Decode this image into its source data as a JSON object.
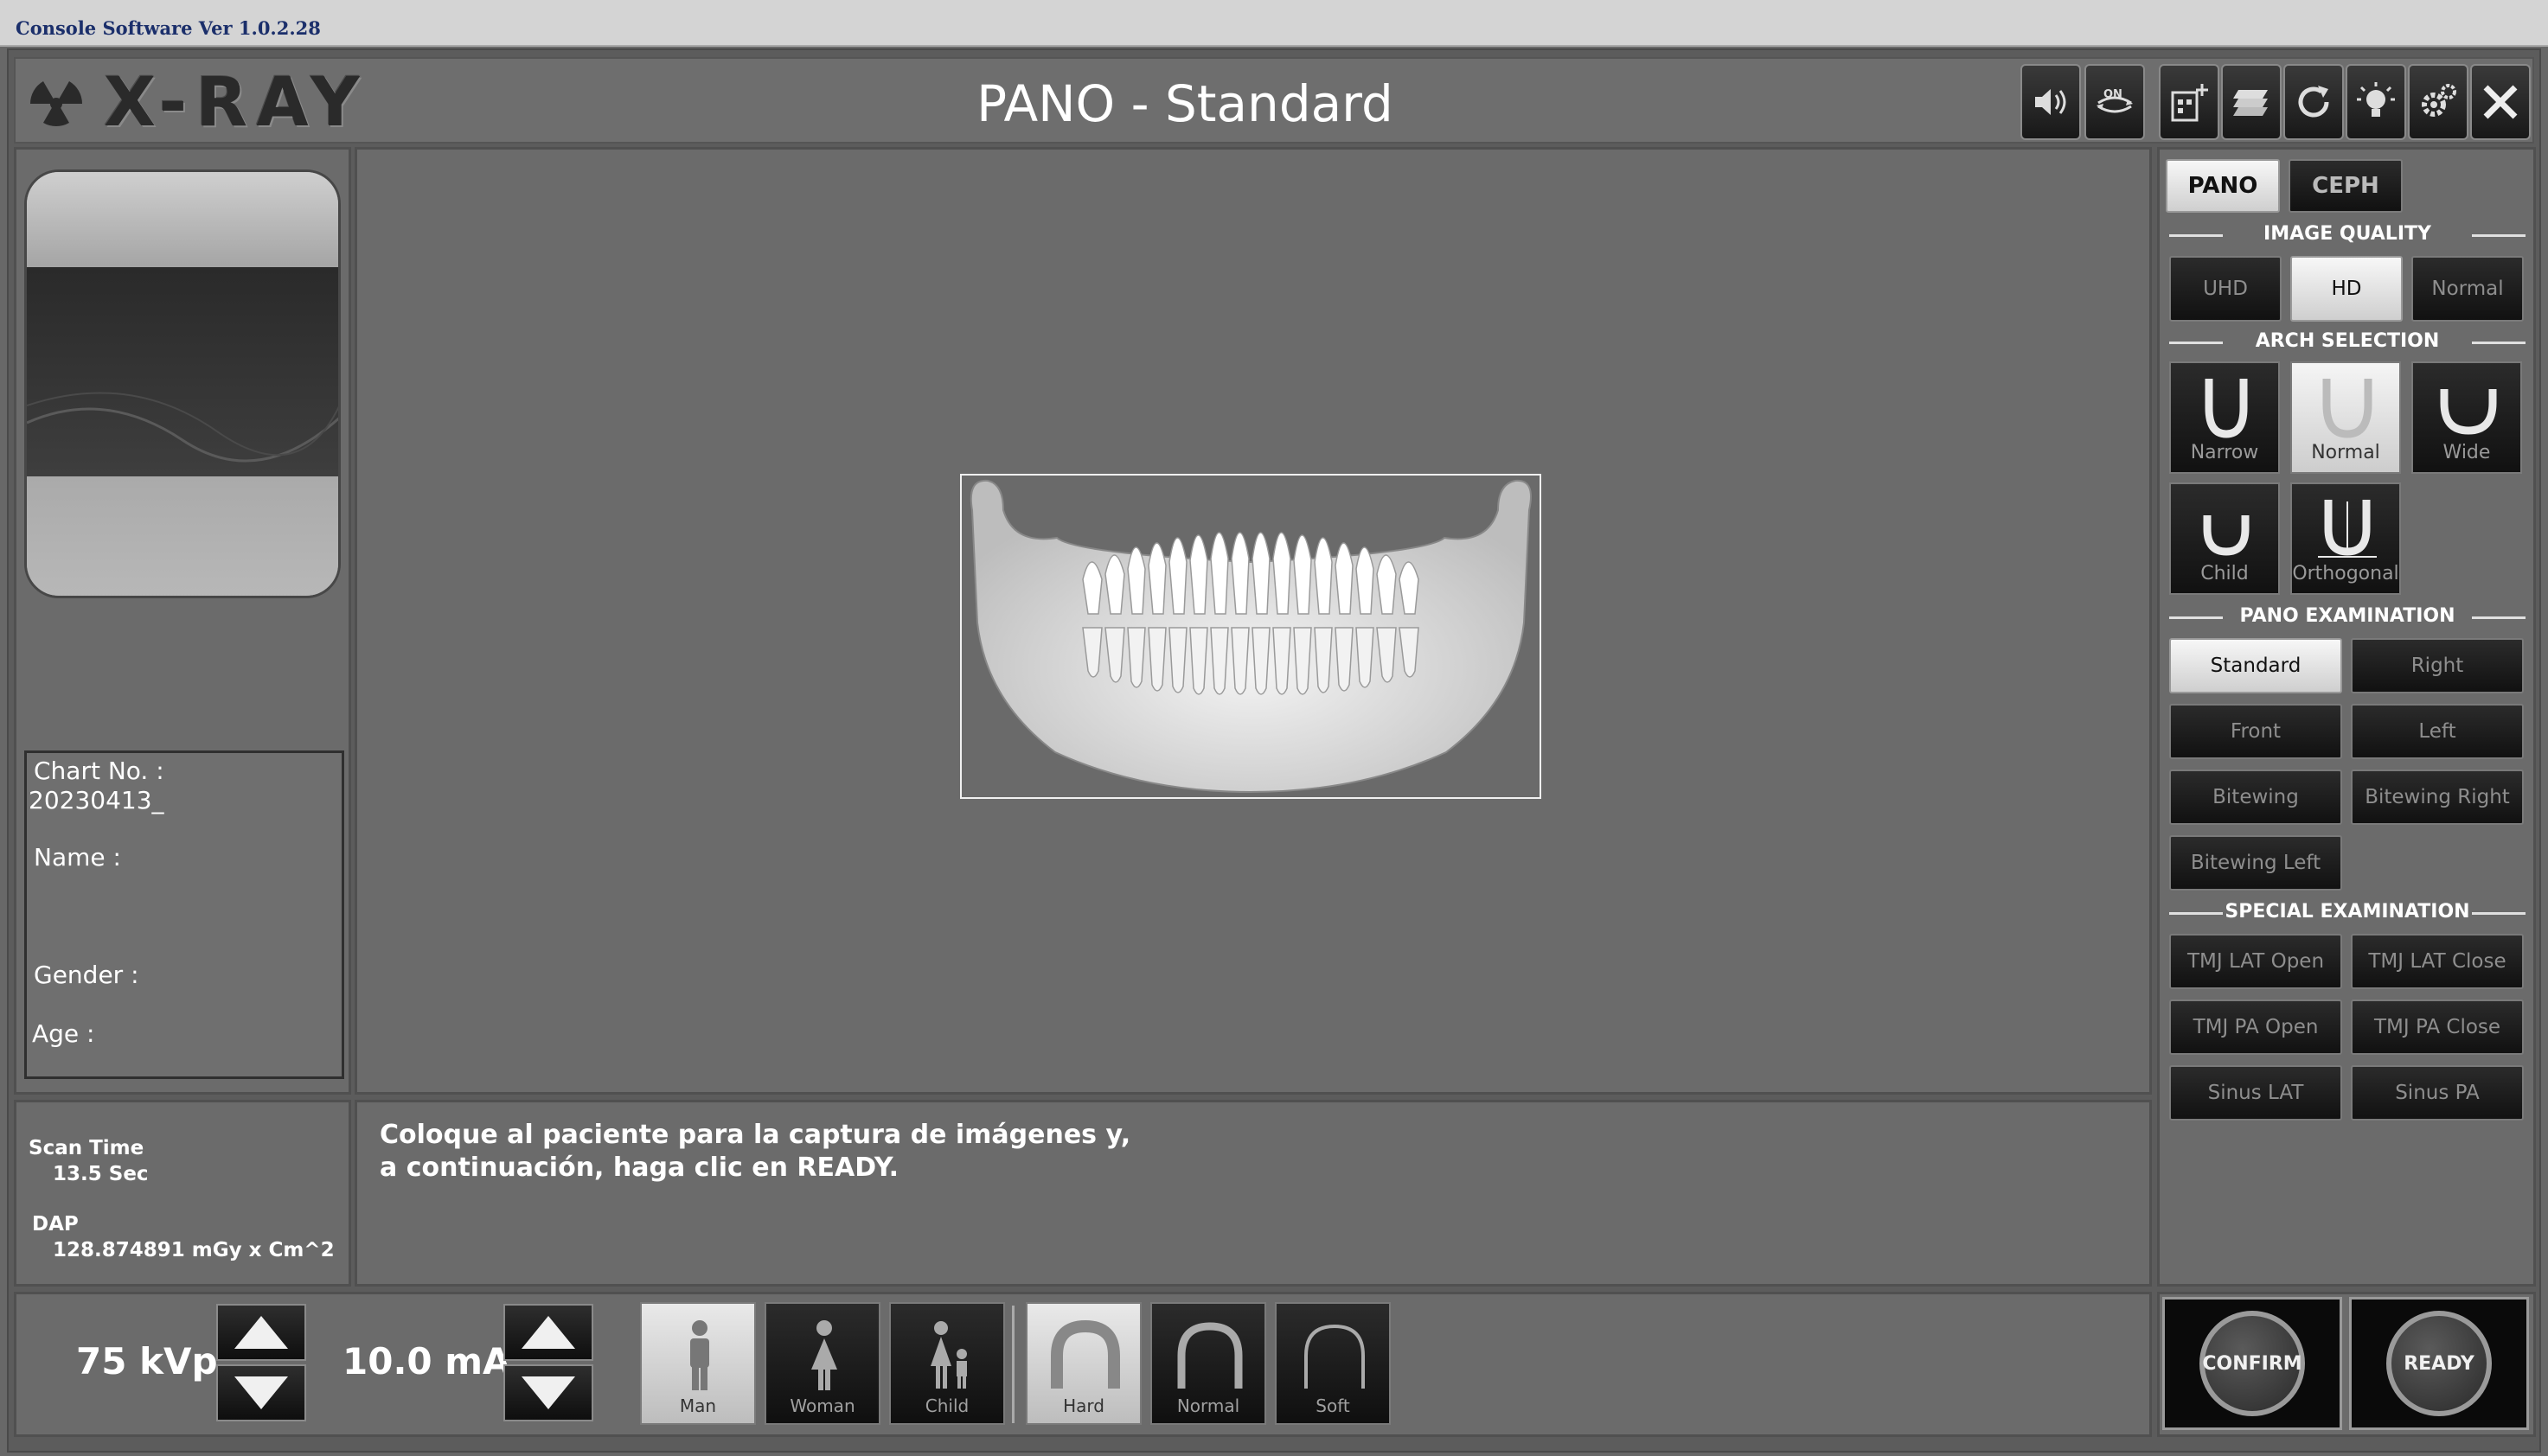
{
  "window": {
    "title": "Console Software Ver 1.0.2.28"
  },
  "header": {
    "logo_text": "X-RAY",
    "title": "PANO - Standard"
  },
  "toolbar": {
    "buttons": [
      {
        "name": "speaker-icon"
      },
      {
        "name": "on-toggle-icon",
        "label": "ON"
      },
      {
        "name": "add-patient-icon"
      },
      {
        "name": "layers-icon"
      },
      {
        "name": "refresh-icon"
      },
      {
        "name": "light-bulb-icon"
      },
      {
        "name": "settings-gear-icon"
      },
      {
        "name": "close-icon"
      }
    ]
  },
  "patient": {
    "chart_label": "Chart No. :",
    "chart_value": "20230413_",
    "name_label": "Name :",
    "gender_label": "Gender :",
    "age_label": "Age :"
  },
  "scan_info": {
    "scan_time_label": "Scan Time",
    "scan_time_value": "13.5 Sec",
    "dap_label": "DAP",
    "dap_value": "128.874891 mGy x Cm^2"
  },
  "message": {
    "line1": "Coloque al paciente para la captura de imágenes y,",
    "line2": "a continuación, haga clic en READY."
  },
  "exposure": {
    "kvp": "75 kVp",
    "ma": "10.0 mA"
  },
  "patient_type": {
    "items": [
      "Man",
      "Woman",
      "Child"
    ],
    "selected": "Man"
  },
  "bone_density": {
    "items": [
      "Hard",
      "Normal",
      "Soft"
    ],
    "selected": "Hard"
  },
  "modes": {
    "pano": "PANO",
    "ceph": "CEPH",
    "selected": "PANO"
  },
  "image_quality": {
    "title": "IMAGE QUALITY",
    "items": [
      "UHD",
      "HD",
      "Normal"
    ],
    "selected": "HD"
  },
  "arch_selection": {
    "title": "ARCH SELECTION",
    "items": [
      "Narrow",
      "Normal",
      "Wide",
      "Child",
      "Orthogonal"
    ],
    "selected": "Normal"
  },
  "pano_exam": {
    "title": "PANO EXAMINATION",
    "items": [
      "Standard",
      "Right",
      "Front",
      "Left",
      "Bitewing",
      "Bitewing Right",
      "Bitewing Left"
    ],
    "selected": "Standard"
  },
  "special_exam": {
    "title": "SPECIAL EXAMINATION",
    "items": [
      "TMJ LAT Open",
      "TMJ LAT Close",
      "TMJ PA Open",
      "TMJ PA Close",
      "Sinus LAT",
      "Sinus PA"
    ]
  },
  "actions": {
    "confirm": "CONFIRM",
    "ready": "READY"
  }
}
